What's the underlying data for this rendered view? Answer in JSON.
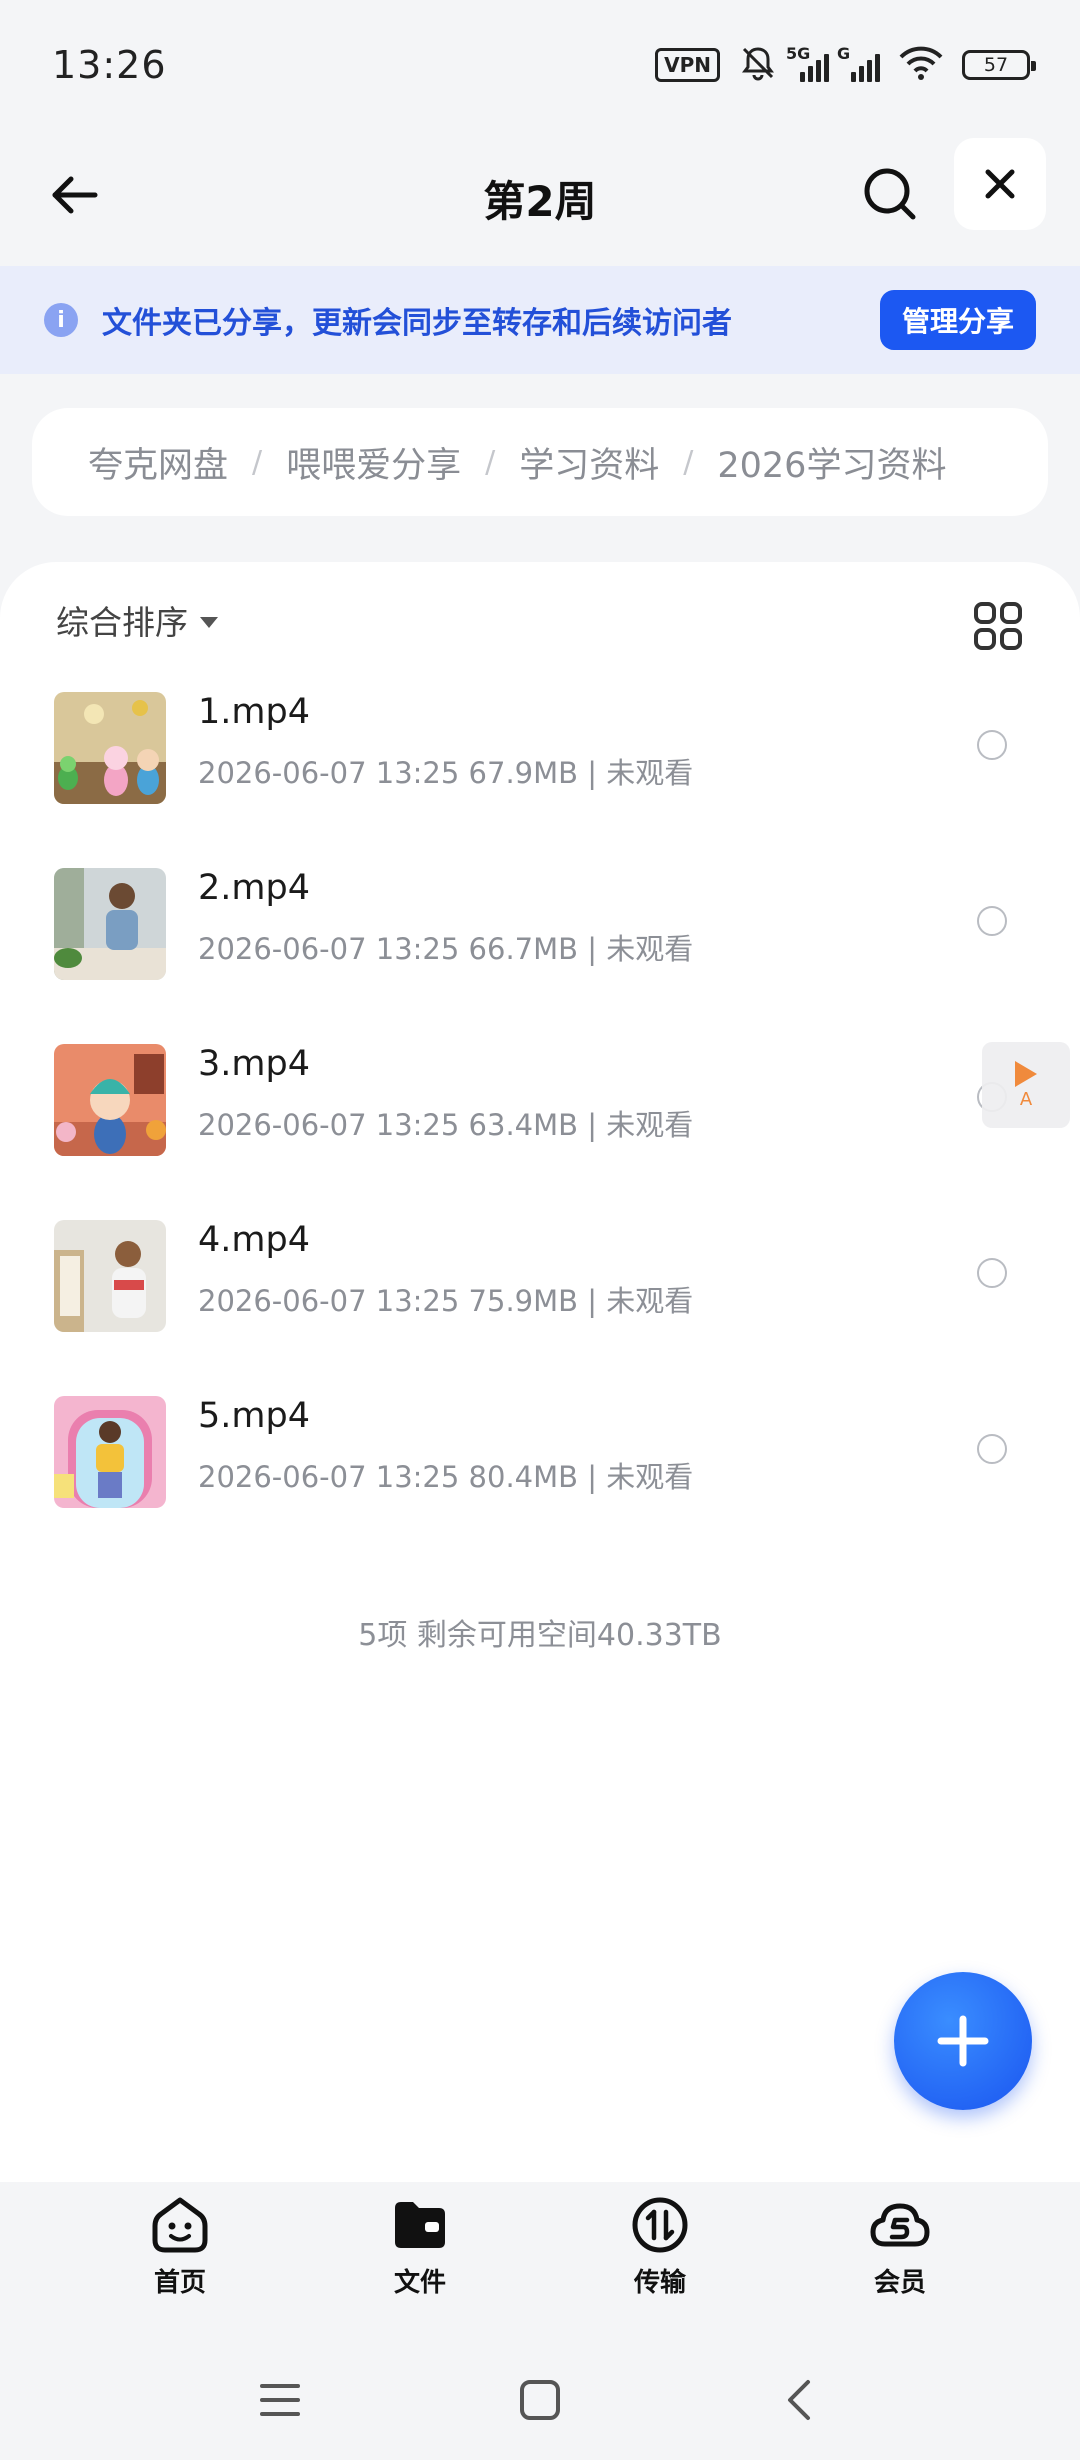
{
  "status_bar": {
    "time": "13:26",
    "vpn": "VPN",
    "sim1_tag": "5G",
    "sim2_tag": "G",
    "battery": "57"
  },
  "header": {
    "title": "第2周"
  },
  "share_banner": {
    "text": "文件夹已分享，更新会同步至转存和后续访问者",
    "button": "管理分享",
    "accent": "#1c58f2"
  },
  "breadcrumb": [
    "夸克网盘",
    "喂喂爱分享",
    "学习资料",
    "2026学习资料"
  ],
  "toolbar": {
    "sort_label": "综合排序"
  },
  "files": [
    {
      "name": "1.mp4",
      "meta": "2026-06-07 13:25  67.9MB | 未观看"
    },
    {
      "name": "2.mp4",
      "meta": "2026-06-07 13:25  66.7MB | 未观看"
    },
    {
      "name": "3.mp4",
      "meta": "2026-06-07 13:25  63.4MB | 未观看"
    },
    {
      "name": "4.mp4",
      "meta": "2026-06-07 13:25  75.9MB | 未观看"
    },
    {
      "name": "5.mp4",
      "meta": "2026-06-07 13:25  80.4MB | 未观看"
    }
  ],
  "footer_info": "5项 剩余可用空间40.33TB",
  "float_helper": {
    "label": "A"
  },
  "bottom_nav": [
    {
      "label": "首页",
      "icon": "smile-face-icon"
    },
    {
      "label": "文件",
      "icon": "folder-icon"
    },
    {
      "label": "传输",
      "icon": "transfer-icon"
    },
    {
      "label": "会员",
      "icon": "member-cloud-icon"
    }
  ]
}
